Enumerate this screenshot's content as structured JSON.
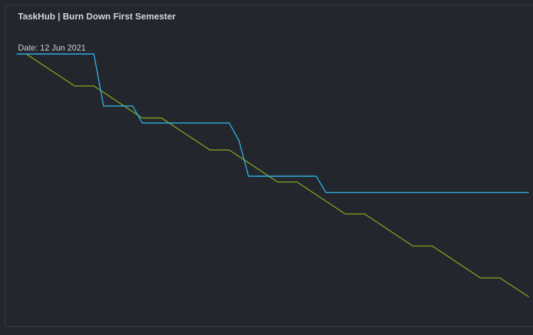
{
  "panel": {
    "title": "TaskHub | Burn Down First Semester",
    "date_label": "Date: 12 Jun 2021"
  },
  "colors": {
    "background": "#23262c",
    "border": "#3b3f46",
    "ideal_line": "#7fa81e",
    "actual_line": "#2fb6ef"
  },
  "chart_data": {
    "type": "line",
    "title": "TaskHub | Burn Down First Semester",
    "xlabel": "",
    "ylabel": "",
    "grid": false,
    "legend": "none",
    "xlim": [
      0,
      53
    ],
    "ylim": [
      0,
      100
    ],
    "series": [
      {
        "color": "#7fa81e",
        "points": [
          [
            1,
            100
          ],
          [
            6,
            88.5
          ],
          [
            8,
            88.5
          ],
          [
            13,
            77
          ],
          [
            15,
            77
          ],
          [
            20,
            65.5
          ],
          [
            22,
            65.5
          ],
          [
            27,
            54
          ],
          [
            29,
            54
          ],
          [
            34,
            42.5
          ],
          [
            36,
            42.5
          ],
          [
            41,
            31
          ],
          [
            43,
            31
          ],
          [
            48,
            19.5
          ],
          [
            50,
            19.5
          ],
          [
            53,
            12.7
          ]
        ]
      },
      {
        "color": "#2fb6ef",
        "points": [
          [
            0,
            100
          ],
          [
            8,
            100
          ],
          [
            9,
            81.3
          ],
          [
            12,
            81.3
          ],
          [
            13,
            75.2
          ],
          [
            22,
            75.2
          ],
          [
            23,
            68.9
          ],
          [
            24,
            56.1
          ],
          [
            31,
            56.1
          ],
          [
            32,
            50.2
          ],
          [
            53,
            50.2
          ]
        ]
      }
    ]
  }
}
